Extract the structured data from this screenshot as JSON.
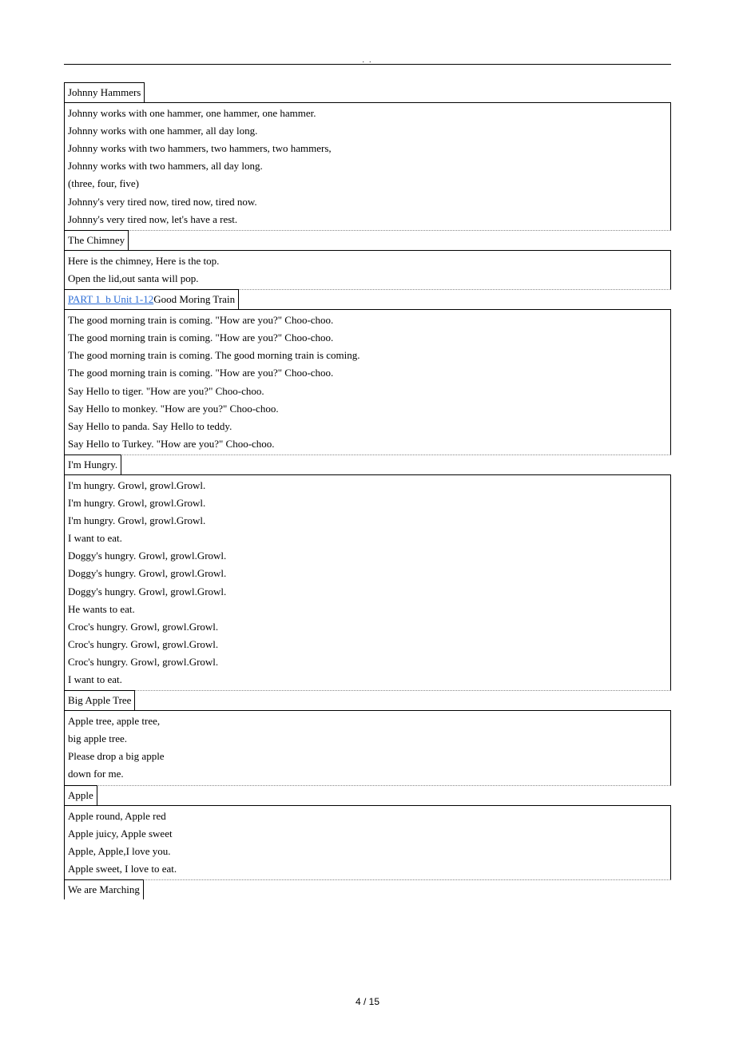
{
  "header_dots": ". .",
  "sections": [
    {
      "title": "Johnny Hammers",
      "body": [
        "Johnny works with one hammer, one hammer, one hammer.",
        "Johnny works with one hammer, all day long.",
        "Johnny works with two hammers, two hammers, two hammers,",
        "Johnny works with two hammers, all day long.",
        "(three, four, five)",
        "Johnny's very tired now, tired now, tired now.",
        "Johnny's very tired now, let's have a rest."
      ]
    },
    {
      "title": "The Chimney",
      "body": [
        "Here is the chimney, Here is the top.",
        "Open the lid,out santa will pop."
      ]
    },
    {
      "title_link": "PART 1_b Unit 1-12",
      "title_after": "Good Moring Train",
      "body": [
        "The good morning train is coming. \"How are you?\" Choo-choo.",
        "The good morning train is coming. \"How are you?\" Choo-choo.",
        "The good morning train is coming. The good morning train is coming.",
        "The good morning train is coming. \"How are you?\" Choo-choo.",
        "Say Hello to tiger. \"How are you?\" Choo-choo.",
        "Say Hello to monkey. \"How are you?\" Choo-choo.",
        "Say Hello to panda. Say Hello to teddy.",
        "Say Hello to Turkey. \"How are you?\" Choo-choo."
      ]
    },
    {
      "title": "I'm Hungry.",
      "body": [
        "I'm hungry. Growl, growl.Growl.",
        "I'm hungry. Growl, growl.Growl.",
        "I'm hungry. Growl, growl.Growl.",
        "I want to eat.",
        "Doggy's hungry. Growl, growl.Growl.",
        "Doggy's hungry. Growl, growl.Growl.",
        "Doggy's hungry. Growl, growl.Growl.",
        "He wants to eat.",
        "Croc's hungry. Growl, growl.Growl.",
        "Croc's hungry. Growl, growl.Growl.",
        "Croc's hungry. Growl, growl.Growl.",
        "I want to eat."
      ]
    },
    {
      "title": "Big Apple Tree",
      "body": [
        "Apple tree, apple tree,",
        "big apple tree.",
        "Please drop a big apple",
        "down for me."
      ]
    },
    {
      "title": "Apple",
      "body": [
        "Apple round, Apple red",
        "Apple juicy, Apple sweet",
        "Apple, Apple,I love you.",
        "Apple sweet, I love to eat."
      ]
    },
    {
      "title": "We are Marching",
      "body": []
    }
  ],
  "page_number": "4 / 15"
}
